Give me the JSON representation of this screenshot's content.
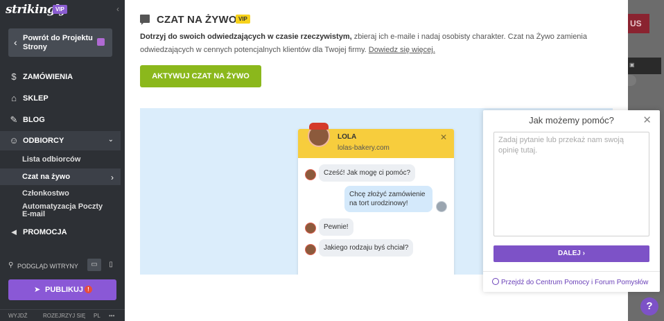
{
  "sidebar": {
    "logo": "strikingly",
    "logo_badge": "VIP",
    "back_label": "Powrót do Projektu Strony",
    "nav": [
      {
        "label": "ZAMÓWIENIA",
        "icon": "dollar-circle-icon"
      },
      {
        "label": "SKLEP",
        "icon": "store-icon"
      },
      {
        "label": "BLOG",
        "icon": "pen-icon"
      },
      {
        "label": "ODBIORCY",
        "icon": "users-icon"
      },
      {
        "label": "PROMOCJA",
        "icon": "megaphone-icon"
      }
    ],
    "sub": [
      {
        "label": "Lista odbiorców"
      },
      {
        "label": "Czat na żywo"
      },
      {
        "label": "Członkostwo"
      },
      {
        "label": "Automatyzacja Poczty E-mail"
      }
    ],
    "preview_label": "PODGLĄD WITRYNY",
    "publish_label": "PUBLIKUJ",
    "publish_warning": "!",
    "footer": {
      "logout": "WYJDŹ",
      "expand": "ROZEJRZYJ SIĘ",
      "lang": "PL",
      "more": "•••"
    }
  },
  "main": {
    "title": "CZAT NA ŻYWO",
    "title_badge": "VIP",
    "desc_bold": "Dotrzyj do swoich odwiedzających w czasie rzeczywistym,",
    "desc_rest": " zbieraj ich e-maile i nadaj osobisty charakter. Czat na Żywo zamienia odwiedzających w cennych potencjalnych klientów dla Twojej firmy. ",
    "desc_link": "Dowiedz się więcej.",
    "activate_label": "AKTYWUJ CZAT NA ŻYWO"
  },
  "chat_preview": {
    "name": "LOLA",
    "site": "lolas-bakery.com",
    "messages": [
      {
        "text": "Cześć! Jak mogę ci pomóc?",
        "side": "left"
      },
      {
        "text": "Chcę złożyć zamówienie na tort urodzinowy!",
        "side": "right"
      },
      {
        "text": "Pewnie!",
        "side": "left"
      },
      {
        "text": "Jakiego rodzaju byś chciał?",
        "side": "left"
      }
    ]
  },
  "help": {
    "title": "Jak możemy pomóc?",
    "placeholder": "Zadaj pytanie lub przekaż nam swoją opinię tutaj.",
    "next_label": "DALEJ",
    "help_link": "Przejdź do Centrum Pomocy i Forum Pomysłów"
  },
  "background": {
    "red_button_fragment": "US"
  },
  "colors": {
    "purple": "#7d52c7",
    "green": "#8bb81c",
    "yellow": "#f7cd3d",
    "sidebar": "#2d3035"
  }
}
